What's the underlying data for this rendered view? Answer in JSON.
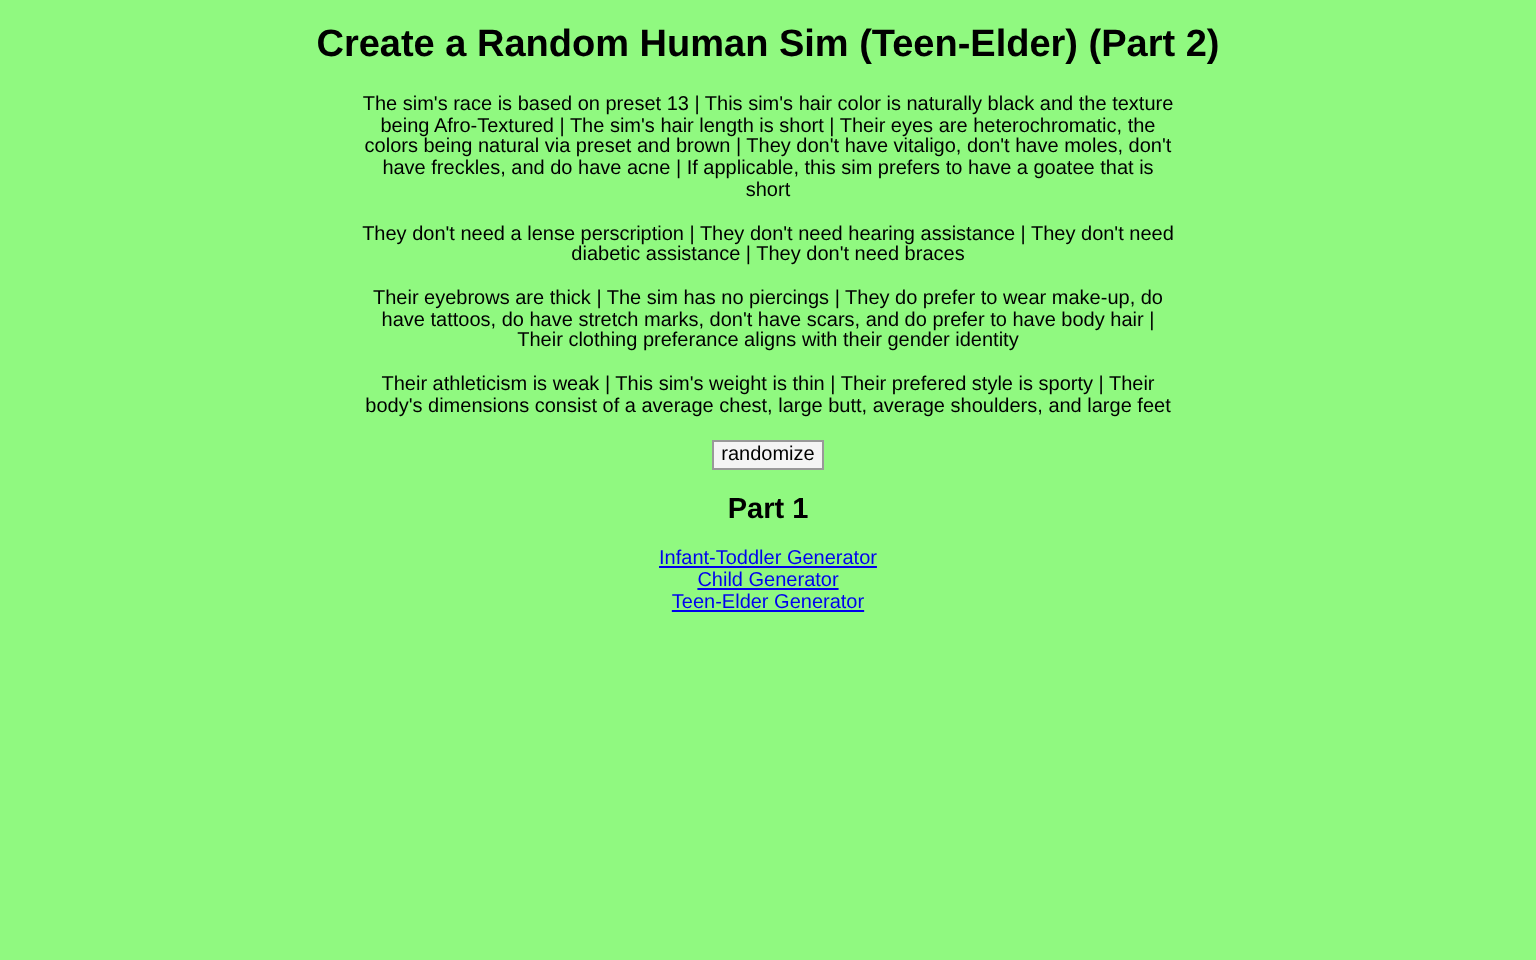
{
  "title": "Create a Random Human Sim (Teen-Elder) (Part 2)",
  "paragraphs": [
    "The sim's race is based on preset 13 | This sim's hair color is naturally black and the texture being Afro-Textured | The sim's hair length is short | Their eyes are heterochromatic, the colors being natural via preset and brown | They don't have vitaligo, don't have moles, don't have freckles, and do have acne | If applicable, this sim prefers to have a goatee that is short",
    "They don't need a lense perscription | They don't need hearing assistance | They don't need diabetic assistance | They don't need braces",
    "Their eyebrows are thick | The sim has no piercings | They do prefer to wear make-up, do have tattoos, do have stretch marks, don't have scars, and do prefer to have body hair | Their clothing preferance aligns with their gender identity",
    "Their athleticism is weak | This sim's weight is thin | Their prefered style is sporty | Their body's dimensions consist of a average chest, large butt, average shoulders, and large feet"
  ],
  "button": "randomize",
  "section_heading": "Part 1",
  "links": [
    "Infant-Toddler Generator",
    "Child Generator",
    "Teen-Elder Generator"
  ]
}
